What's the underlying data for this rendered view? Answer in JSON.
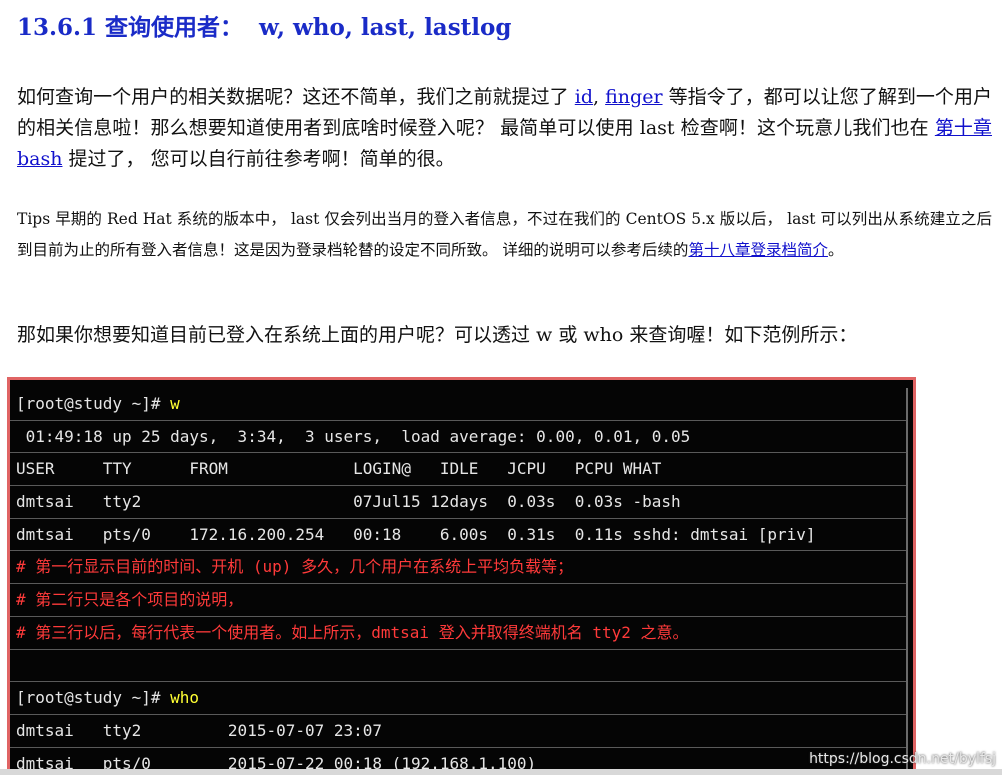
{
  "heading": {
    "number": "13.6.1",
    "title": "查询使用者：",
    "commands": "w, who, last, lastlog"
  },
  "para1": {
    "text_a": "如何查询一个用户的相关数据呢？这还不简单，我们之前就提过了 ",
    "link_id": "id",
    "sep": ", ",
    "link_finger": "finger",
    "text_b": " 等指令了，都可以让您了解到一个用户的相关信息啦！那么想要知道使用者到底啥时候登入呢？ 最简单可以使用 last 检查啊！这个玩意儿我们也在 ",
    "link_bash": "第十章 bash",
    "text_c": " 提过了， 您可以自行前往参考啊！简单的很。"
  },
  "tips": {
    "text_a": "Tips 早期的 Red Hat 系统的版本中， last 仅会列出当月的登入者信息，不过在我们的 CentOS 5.x 版以后， last 可以列出从系统建立之后到目前为止的所有登入者信息！这是因为登录档轮替的设定不同所致。 详细的说明可以参考后续的",
    "link": "第十八章登录档简介",
    "text_b": "。"
  },
  "para2": {
    "text": "那如果你想要知道目前已登入在系统上面的用户呢？可以透过 w 或 who 来查询喔！如下范例所示："
  },
  "terminal": {
    "prompt1": "[root@study ~]# ",
    "cmd1": "w",
    "uptime": " 01:49:18 up 25 days,  3:34,  3 users,  load average: 0.00, 0.01, 0.05",
    "header": "USER     TTY      FROM             LOGIN@   IDLE   JCPU   PCPU WHAT",
    "row1": "dmtsai   tty2                      07Jul15 12days  0.03s  0.03s -bash",
    "row2": "dmtsai   pts/0    172.16.200.254   00:18    6.00s  0.31s  0.11s sshd: dmtsai [priv]",
    "comment1": "# 第一行显示目前的时间、开机 (up) 多久，几个用户在系统上平均负载等；",
    "comment2": "# 第二行只是各个项目的说明，",
    "comment3": "# 第三行以后，每行代表一个使用者。如上所示，dmtsai 登入并取得终端机名 tty2 之意。",
    "prompt2": "[root@study ~]# ",
    "cmd2": "who",
    "who1": "dmtsai   tty2         2015-07-07 23:07",
    "who2": "dmtsai   pts/0        2015-07-22 00:18 (192.168.1.100)"
  },
  "watermark": "https://blog.csdn.net/bylfsj",
  "colors": {
    "heading": "#1a2bc7",
    "link": "#1010cc",
    "terminal_bg": "#050505",
    "terminal_border": "#e06464",
    "comment": "#ff3a3a",
    "command": "#ffff33"
  }
}
